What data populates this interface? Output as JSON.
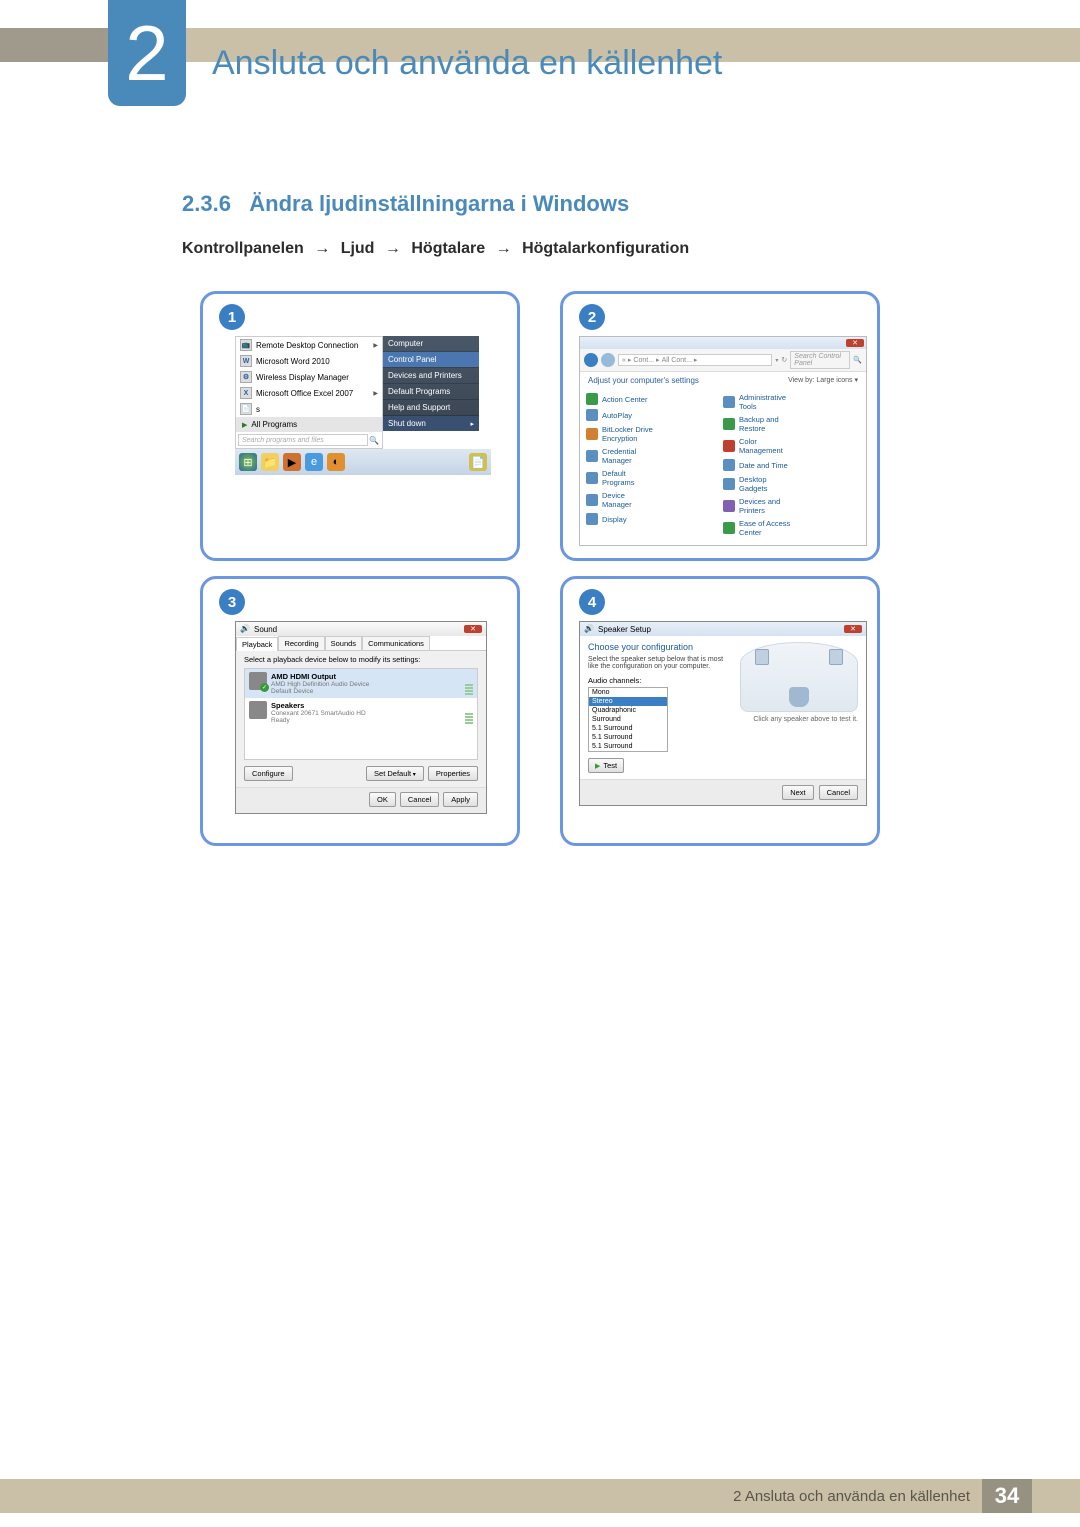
{
  "chapter": {
    "number": "2",
    "title": "Ansluta och använda en källenhet"
  },
  "section": {
    "number": "2.3.6",
    "title": "Ändra ljudinställningarna i Windows"
  },
  "breadcrumb": [
    "Kontrollpanelen",
    "Ljud",
    "Högtalare",
    "Högtalarkonfiguration"
  ],
  "arrow_glyph": "→",
  "steps": {
    "s1": "1",
    "s2": "2",
    "s3": "3",
    "s4": "4"
  },
  "panel1": {
    "left_items": [
      {
        "label": "Remote Desktop Connection",
        "icon": "📺",
        "sub": true
      },
      {
        "label": "Microsoft Word 2010",
        "icon": "W",
        "sub": false
      },
      {
        "label": "Wireless Display Manager",
        "icon": "⚙",
        "sub": false
      },
      {
        "label": "Microsoft Office Excel 2007",
        "icon": "X",
        "sub": true
      },
      {
        "label": "s",
        "icon": "📄",
        "sub": false
      }
    ],
    "all_programs": "All Programs",
    "search_placeholder": "Search programs and files",
    "right_items": [
      "Computer",
      "Control Panel",
      "Devices and Printers",
      "Default Programs",
      "Help and Support"
    ],
    "right_highlight_index": 1,
    "shutdown": "Shut down"
  },
  "panel2": {
    "close": "✕",
    "path_parts": [
      "«",
      "Cont...",
      "All Cont...",
      "»"
    ],
    "search_placeholder": "Search Control Panel",
    "adjust": "Adjust your computer's settings",
    "view_by": "View by: Large icons ▾",
    "items_left": [
      {
        "t": "Action Center",
        "c": "g"
      },
      {
        "t": "AutoPlay",
        "c": ""
      },
      {
        "t": "BitLocker Drive Encryption",
        "c": "o"
      },
      {
        "t": "Credential Manager",
        "c": ""
      },
      {
        "t": "Default Programs",
        "c": ""
      },
      {
        "t": "Device Manager",
        "c": ""
      },
      {
        "t": "Display",
        "c": ""
      }
    ],
    "items_right": [
      {
        "t": "Administrative Tools",
        "c": ""
      },
      {
        "t": "Backup and Restore",
        "c": "g"
      },
      {
        "t": "Color Management",
        "c": "r"
      },
      {
        "t": "Date and Time",
        "c": ""
      },
      {
        "t": "Desktop Gadgets",
        "c": ""
      },
      {
        "t": "Devices and Printers",
        "c": "p"
      },
      {
        "t": "Ease of Access Center",
        "c": "g"
      }
    ]
  },
  "panel3": {
    "title": "Sound",
    "close": "✕",
    "tabs": [
      "Playback",
      "Recording",
      "Sounds",
      "Communications"
    ],
    "active_tab": 0,
    "instruction": "Select a playback device below to modify its settings:",
    "devices": [
      {
        "name": "AMD HDMI Output",
        "desc1": "AMD High Definition Audio Device",
        "desc2": "Default Device",
        "checked": true,
        "selected": true
      },
      {
        "name": "Speakers",
        "desc1": "Conexant 20671 SmartAudio HD",
        "desc2": "Ready",
        "checked": false,
        "selected": false
      }
    ],
    "btn_configure": "Configure",
    "btn_setdefault": "Set Default",
    "btn_properties": "Properties",
    "btn_ok": "OK",
    "btn_cancel": "Cancel",
    "btn_apply": "Apply"
  },
  "panel4": {
    "title": "Speaker Setup",
    "close": "✕",
    "heading": "Choose your configuration",
    "instruction": "Select the speaker setup below that is most like the configuration on your computer.",
    "channels_label": "Audio channels:",
    "options": [
      "Mono",
      "Stereo",
      "Quadraphonic",
      "Surround",
      "5.1 Surround",
      "5.1 Surround",
      "5.1 Surround"
    ],
    "selected_index": 1,
    "btn_test": "Test",
    "hint": "Click any speaker above to test it.",
    "btn_next": "Next",
    "btn_cancel": "Cancel"
  },
  "footer": {
    "text": "2 Ansluta och använda en källenhet",
    "page": "34"
  }
}
